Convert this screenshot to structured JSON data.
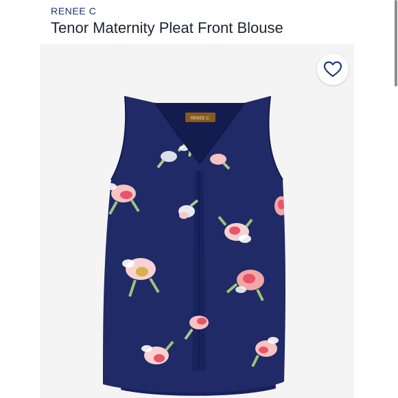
{
  "listing": {
    "brand": "RENEE C",
    "title": "Tenor Maternity Pleat Front Blouse"
  },
  "product_image": {
    "garment_color": "#1f2a66",
    "print": "floral",
    "neck_label": "RENEE C."
  },
  "icons": {
    "like": "heart-icon"
  },
  "colors": {
    "brand_text": "#1e2e6e",
    "title_text": "#1b2430",
    "photo_background": "#f4f4f4",
    "heart_stroke": "#1e3a7a"
  }
}
